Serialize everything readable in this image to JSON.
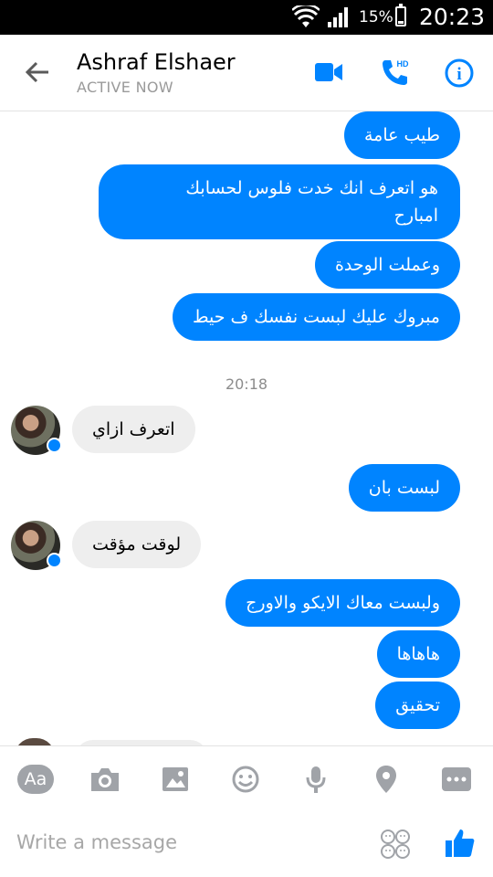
{
  "status_bar": {
    "battery_percent": "15%",
    "battery_level": 0.15,
    "time": "20:23",
    "icons": [
      "wifi-icon",
      "signal-icon",
      "battery-icon"
    ]
  },
  "header": {
    "contact_name": "Ashraf Elshaer",
    "status": "ACTIVE NOW",
    "icons": [
      "back-arrow-icon",
      "video-call-icon",
      "hd-call-icon",
      "info-icon"
    ],
    "call_badge": "HD",
    "info_glyph": "i"
  },
  "colors": {
    "accent": "#0084ff",
    "incoming_bubble": "#eeeeee",
    "icon_gray": "#a0a3a8"
  },
  "messages": [
    {
      "direction": "outgoing",
      "text": "طيب عامة"
    },
    {
      "direction": "outgoing",
      "text": "هو اتعرف انك خدت فلوس لحسابك امبارح"
    },
    {
      "direction": "outgoing",
      "text": "وعملت الوحدة"
    },
    {
      "direction": "outgoing",
      "text": "مبروك عليك لبست نفسك ف حيط"
    },
    {
      "direction": "incoming",
      "text": "اتعرف ازاي"
    },
    {
      "direction": "outgoing",
      "text": "لبست بان"
    },
    {
      "direction": "incoming",
      "text": "لوقت مؤقت"
    },
    {
      "direction": "outgoing",
      "text": "ولبست معاك الايكو والاورج"
    },
    {
      "direction": "outgoing",
      "text": "هاهاها"
    },
    {
      "direction": "outgoing",
      "text": "تحقيق"
    }
  ],
  "message_lines": {
    "msg1_line1": "هو اتعرف انك خدت فلوس لحسابك",
    "msg1_line2": "امبارح"
  },
  "timestamp": "20:18",
  "toolbar": {
    "text_button_label": "Aa",
    "icons": [
      "text-format-icon",
      "camera-icon",
      "gallery-icon",
      "emoji-icon",
      "microphone-icon",
      "location-icon",
      "more-icon"
    ]
  },
  "composer": {
    "placeholder": "Write a message",
    "icons": [
      "stickers-icon",
      "thumbs-up-icon"
    ]
  }
}
